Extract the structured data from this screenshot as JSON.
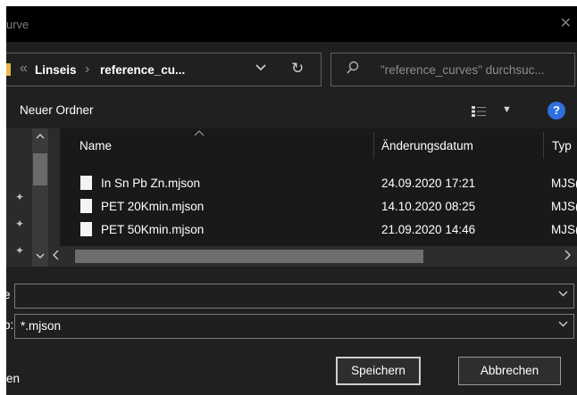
{
  "window": {
    "title": "urve",
    "close_glyph": "✕"
  },
  "address_bar": {
    "breadcrumb_sep": "«",
    "crumb1": "Linseis",
    "crumb_sep": "›",
    "crumb2": "reference_cu...",
    "dropdown_glyph": "⌄",
    "refresh_glyph": "↻"
  },
  "search": {
    "icon": "search-icon",
    "placeholder": "\"reference_curves\" durchsuc..."
  },
  "toolbar": {
    "new_folder_label": "Neuer Ordner",
    "view_dropdown_glyph": "▼",
    "help_label": "?"
  },
  "columns": {
    "name": "Name",
    "date": "Änderungsdatum",
    "type": "Typ"
  },
  "files": [
    {
      "name": "In Sn Pb Zn.mjson",
      "date": "24.09.2020 17:21",
      "type": "MJS("
    },
    {
      "name": "PET 20Kmin.mjson",
      "date": "14.10.2020 08:25",
      "type": "MJS("
    },
    {
      "name": "PET 50Kmin.mjson",
      "date": "21.09.2020 14:46",
      "type": "MJS("
    }
  ],
  "filename_field": {
    "label": "e",
    "value": ""
  },
  "filetype_field": {
    "label": "p:",
    "value": "*.mjson"
  },
  "footer": {
    "hide_folders_label": "en",
    "save_label": "Speichern",
    "cancel_label": "Abbrechen"
  },
  "colors": {
    "background": "#202020",
    "titlebar": "#000000",
    "accent_help": "#2f6fe0",
    "folder": "#e6b94a"
  }
}
